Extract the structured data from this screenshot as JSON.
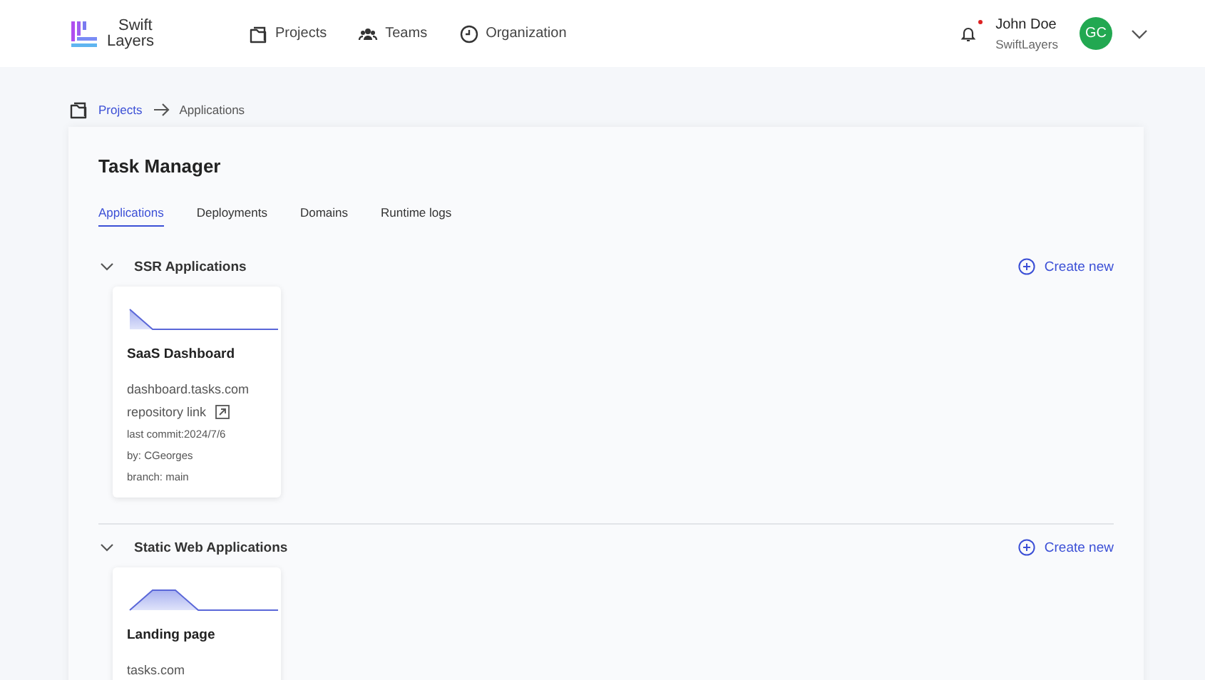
{
  "header": {
    "logo_text": [
      "Swift",
      "Layers"
    ],
    "nav": [
      {
        "label": "Projects"
      },
      {
        "label": "Teams"
      },
      {
        "label": "Organization"
      }
    ],
    "notifications": {
      "unread": true
    },
    "user": {
      "name": "John Doe",
      "org": "SwiftLayers",
      "initials": "GC",
      "color": "#22a851"
    }
  },
  "breadcrumb": [
    {
      "label": "Projects",
      "link": true
    },
    {
      "label": "Applications",
      "link": false
    }
  ],
  "page": {
    "title": "Task Manager"
  },
  "tabs": [
    {
      "label": "Applications",
      "selected": true
    },
    {
      "label": "Deployments",
      "selected": false
    },
    {
      "label": "Domains",
      "selected": false
    },
    {
      "label": "Runtime logs",
      "selected": false
    }
  ],
  "sections": [
    {
      "title": "SSR Applications",
      "expanded": true,
      "action": "Create new",
      "apps": [
        {
          "name": "SaaS Dashboard",
          "domain": "dashboard.tasks.com",
          "repo_link": "repository link",
          "last_commit": "last commit:2024/7/6",
          "author": "by: CGeorges",
          "branch": "branch: main"
        }
      ]
    },
    {
      "title": "Static Web Applications",
      "expanded": true,
      "action": "Create new",
      "apps": [
        {
          "name": "Landing page",
          "domain": "tasks.com"
        }
      ]
    }
  ]
}
